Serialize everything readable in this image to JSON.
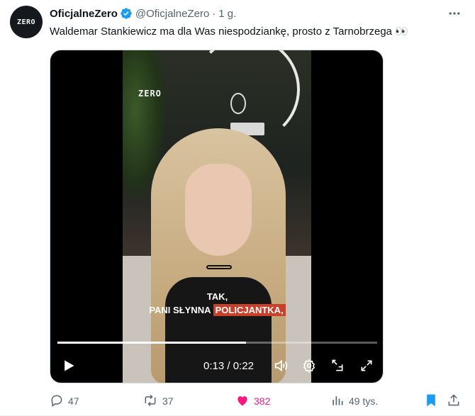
{
  "author": {
    "name": "OficjalneZero",
    "handle": "@OficjalneZero",
    "separator": "·",
    "time": "1 g.",
    "avatar_text": "ZERO"
  },
  "tweet": {
    "text": "Waldemar Stankiewicz ma dla Was niespodziankę, prosto z Tarnobrzega 👀"
  },
  "video": {
    "watermark": "ZERO",
    "subtitle_line1": "TAK,",
    "subtitle_line2_plain": "PANI SŁYNNA",
    "subtitle_line2_highlight": "POLICJANTKA,",
    "current_time": "0:13",
    "time_separator": "/",
    "duration": "0:22",
    "progress_fraction": 0.59
  },
  "actions": {
    "replies": "47",
    "reposts": "37",
    "likes": "382",
    "views": "49 tys."
  },
  "colors": {
    "like": "#f91880",
    "verified": "#1d9bf0",
    "bookmark": "#1d9bf0",
    "subtitle_highlight": "#c8402a"
  },
  "icons": [
    "verified-badge-icon",
    "more-icon",
    "play-icon",
    "volume-icon",
    "settings-icon",
    "pip-icon",
    "fullscreen-icon",
    "reply-icon",
    "repost-icon",
    "heart-icon",
    "views-icon",
    "bookmark-icon",
    "share-icon"
  ]
}
